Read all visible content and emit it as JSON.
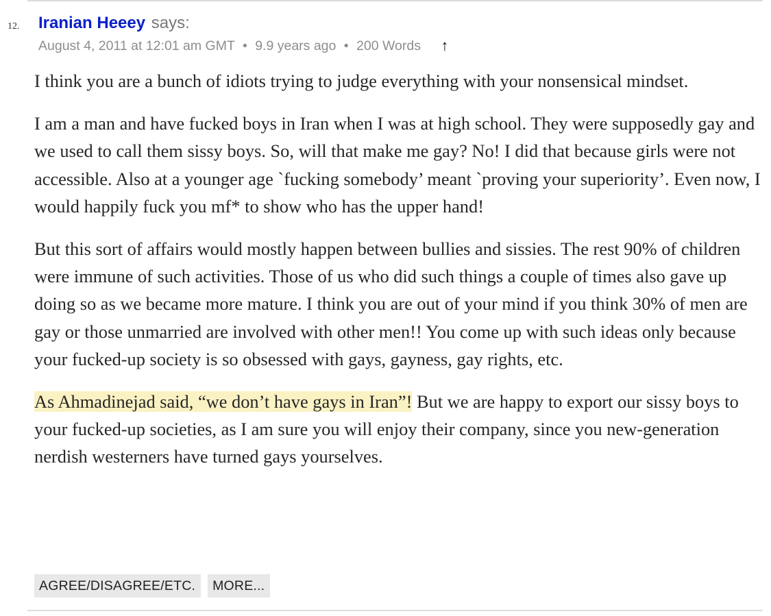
{
  "comment": {
    "number": "12.",
    "author": "Iranian Heeey",
    "says": "says:",
    "date": "August 4, 2011 at 12:01 am GMT",
    "age": "9.9 years ago",
    "words": "200 Words",
    "separator": "•",
    "up_arrow": "↑",
    "paragraphs": [
      "I think you are a bunch of idiots trying to judge everything with your nonsensical mindset.",
      "I am a man and have fucked boys in Iran when I was at high school. They were supposedly gay and we used to call them sissy boys. So, will that make me gay? No! I did that because girls were not accessible. Also at a younger age `fucking somebody’ meant `proving your superiority’. Even now, I would happily fuck you mf* to show who has the upper hand!",
      "But this sort of affairs would mostly happen between bullies and sissies. The rest 90% of children were immune of such activities. Those of us who did such things a couple of times also gave up doing so as we became more mature. I think you are out of your mind if you think 30% of men are gay or those unmarried are involved with other men!! You come up with such ideas only because your fucked-up society is so obsessed with gays, gayness, gay rights, etc."
    ],
    "last_paragraph_highlight": "As Ahmadinejad said, “we don’t have gays in Iran”!",
    "last_paragraph_rest": " But we are happy to export our sissy boys to your fucked-up societies, as I am sure you will enjoy their company, since you new-generation nerdish westerners have turned gays yourselves.",
    "highlight_color": "#fbf2c4",
    "author_color": "#0a20c8"
  },
  "buttons": {
    "agree": "AGREE/DISAGREE/ETC.",
    "more": "MORE..."
  }
}
